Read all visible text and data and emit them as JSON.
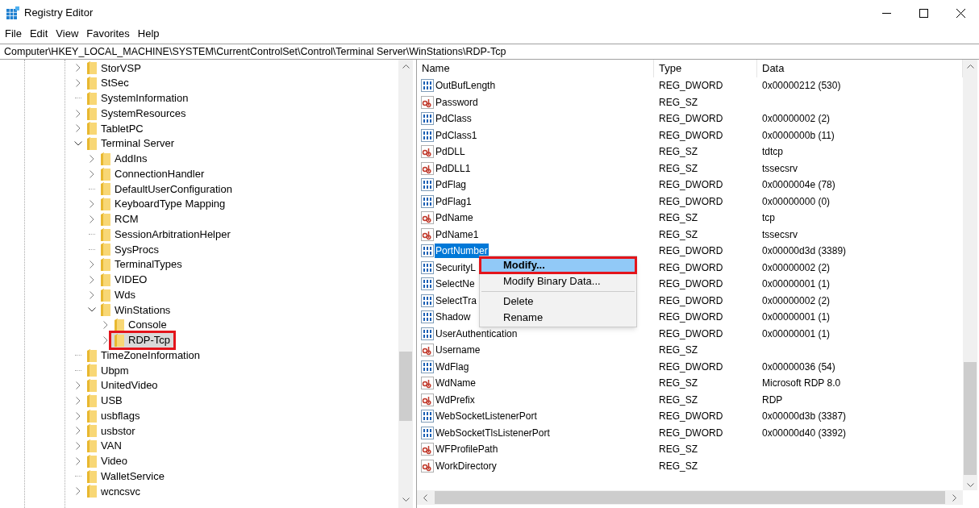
{
  "window": {
    "title": "Registry Editor"
  },
  "menu_bar": [
    "File",
    "Edit",
    "View",
    "Favorites",
    "Help"
  ],
  "address_bar": {
    "value": "Computer\\HKEY_LOCAL_MACHINE\\SYSTEM\\CurrentControlSet\\Control\\Terminal Server\\WinStations\\RDP-Tcp"
  },
  "tree": [
    {
      "label": "StorVSP",
      "kind": "collapsed",
      "selected": false
    },
    {
      "label": "StSec",
      "kind": "collapsed",
      "selected": false
    },
    {
      "label": "SystemInformation",
      "kind": "leaf",
      "selected": false
    },
    {
      "label": "SystemResources",
      "kind": "collapsed",
      "selected": false
    },
    {
      "label": "TabletPC",
      "kind": "collapsed",
      "selected": false
    },
    {
      "label": "Terminal Server",
      "kind": "expanded",
      "selected": false,
      "children": [
        {
          "label": "AddIns",
          "kind": "collapsed",
          "selected": false
        },
        {
          "label": "ConnectionHandler",
          "kind": "collapsed",
          "selected": false
        },
        {
          "label": "DefaultUserConfiguration",
          "kind": "leaf",
          "selected": false
        },
        {
          "label": "KeyboardType Mapping",
          "kind": "collapsed",
          "selected": false
        },
        {
          "label": "RCM",
          "kind": "collapsed",
          "selected": false
        },
        {
          "label": "SessionArbitrationHelper",
          "kind": "leaf",
          "selected": false
        },
        {
          "label": "SysProcs",
          "kind": "leaf",
          "selected": false
        },
        {
          "label": "TerminalTypes",
          "kind": "collapsed",
          "selected": false
        },
        {
          "label": "VIDEO",
          "kind": "collapsed",
          "selected": false
        },
        {
          "label": "Wds",
          "kind": "collapsed",
          "selected": false
        },
        {
          "label": "WinStations",
          "kind": "expanded",
          "selected": false,
          "children": [
            {
              "label": "Console",
              "kind": "collapsed",
              "selected": false
            },
            {
              "label": "RDP-Tcp",
              "kind": "collapsed",
              "selected": true,
              "callout": true
            }
          ]
        }
      ]
    },
    {
      "label": "TimeZoneInformation",
      "kind": "leaf",
      "selected": false
    },
    {
      "label": "Ubpm",
      "kind": "leaf",
      "selected": false
    },
    {
      "label": "UnitedVideo",
      "kind": "collapsed",
      "selected": false
    },
    {
      "label": "USB",
      "kind": "collapsed",
      "selected": false
    },
    {
      "label": "usbflags",
      "kind": "collapsed",
      "selected": false
    },
    {
      "label": "usbstor",
      "kind": "collapsed",
      "selected": false
    },
    {
      "label": "VAN",
      "kind": "collapsed",
      "selected": false
    },
    {
      "label": "Video",
      "kind": "collapsed",
      "selected": false
    },
    {
      "label": "WalletService",
      "kind": "leaf",
      "selected": false
    },
    {
      "label": "wcncsvc",
      "kind": "collapsed",
      "selected": false
    }
  ],
  "values_table": {
    "columns": [
      "Name",
      "Type",
      "Data"
    ],
    "rows": [
      {
        "kind": "binary",
        "name": "OutBufLength",
        "type": "REG_DWORD",
        "data": "0x00000212 (530)",
        "selected": false
      },
      {
        "kind": "string",
        "name": "Password",
        "type": "REG_SZ",
        "selected": false
      },
      {
        "kind": "binary",
        "name": "PdClass",
        "type": "REG_DWORD",
        "data": "0x00000002 (2)",
        "selected": false
      },
      {
        "kind": "binary",
        "name": "PdClass1",
        "type": "REG_DWORD",
        "data": "0x0000000b (11)",
        "selected": false
      },
      {
        "kind": "string",
        "name": "PdDLL",
        "type": "REG_SZ",
        "data": "tdtcp",
        "selected": false
      },
      {
        "kind": "string",
        "name": "PdDLL1",
        "type": "REG_SZ",
        "data": "tssecsrv",
        "selected": false
      },
      {
        "kind": "binary",
        "name": "PdFlag",
        "type": "REG_DWORD",
        "data": "0x0000004e (78)",
        "selected": false
      },
      {
        "kind": "binary",
        "name": "PdFlag1",
        "type": "REG_DWORD",
        "data": "0x00000000 (0)",
        "selected": false
      },
      {
        "kind": "string",
        "name": "PdName",
        "type": "REG_SZ",
        "data": "tcp",
        "selected": false
      },
      {
        "kind": "string",
        "name": "PdName1",
        "type": "REG_SZ",
        "data": "tssecsrv",
        "selected": false
      },
      {
        "kind": "binary",
        "name": "PortNumber",
        "type": "REG_DWORD",
        "data": "0x00000d3d (3389)",
        "selected": true
      },
      {
        "kind": "binary",
        "name": "SecurityL",
        "type": "REG_DWORD",
        "data": "0x00000002 (2)",
        "selected": false
      },
      {
        "kind": "binary",
        "name": "SelectNe",
        "type": "REG_DWORD",
        "data": "0x00000001 (1)",
        "selected": false
      },
      {
        "kind": "binary",
        "name": "SelectTra",
        "type": "REG_DWORD",
        "data": "0x00000002 (2)",
        "selected": false
      },
      {
        "kind": "binary",
        "name": "Shadow",
        "type": "REG_DWORD",
        "data": "0x00000001 (1)",
        "selected": false
      },
      {
        "kind": "binary",
        "name": "UserAuthentication",
        "type": "REG_DWORD",
        "data": "0x00000001 (1)",
        "selected": false
      },
      {
        "kind": "string",
        "name": "Username",
        "type": "REG_SZ",
        "selected": false
      },
      {
        "kind": "binary",
        "name": "WdFlag",
        "type": "REG_DWORD",
        "data": "0x00000036 (54)",
        "selected": false
      },
      {
        "kind": "string",
        "name": "WdName",
        "type": "REG_SZ",
        "data": "Microsoft RDP 8.0",
        "selected": false
      },
      {
        "kind": "string",
        "name": "WdPrefix",
        "type": "REG_SZ",
        "data": "RDP",
        "selected": false
      },
      {
        "kind": "binary",
        "name": "WebSocketListenerPort",
        "type": "REG_DWORD",
        "data": "0x00000d3b (3387)",
        "selected": false
      },
      {
        "kind": "binary",
        "name": "WebSocketTlsListenerPort",
        "type": "REG_DWORD",
        "data": "0x00000d40 (3392)",
        "selected": false
      },
      {
        "kind": "string",
        "name": "WFProfilePath",
        "type": "REG_SZ",
        "selected": false
      },
      {
        "kind": "string",
        "name": "WorkDirectory",
        "type": "REG_SZ",
        "selected": false
      }
    ]
  },
  "context_menu": [
    {
      "kind": "item",
      "label": "Modify...",
      "default": true,
      "selected": true,
      "callout": true
    },
    {
      "kind": "item",
      "label": "Modify Binary Data...",
      "default": false,
      "selected": false,
      "callout": false
    },
    {
      "kind": "separator"
    },
    {
      "kind": "item",
      "label": "Delete",
      "default": false,
      "selected": false,
      "callout": false
    },
    {
      "kind": "item",
      "label": "Rename",
      "default": false,
      "selected": false,
      "callout": false
    }
  ]
}
